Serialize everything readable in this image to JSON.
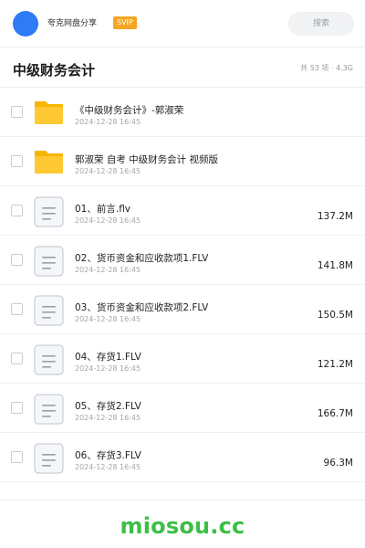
{
  "header": {
    "app_title": "夸克网盘分享",
    "badge": "SVIP",
    "search_placeholder": "搜索",
    "accent_color": "#2f7bf6",
    "badge_color": "#f5a623"
  },
  "folder": {
    "title": "中级财务会计",
    "meta": "共 53 项 · 4.3G"
  },
  "files": [
    {
      "type": "folder",
      "name": "《中级财务会计》-郭淑荣",
      "date": "2024-12-28 16:45",
      "size": ""
    },
    {
      "type": "folder",
      "name": "郭淑荣 自考 中级财务会计  视频版",
      "date": "2024-12-28 16:45",
      "size": ""
    },
    {
      "type": "file",
      "name": "01、前言.flv",
      "date": "2024-12-28 16:45",
      "size": "137.2M"
    },
    {
      "type": "file",
      "name": "02、货币资金和应收款项1.FLV",
      "date": "2024-12-28 16:45",
      "size": "141.8M"
    },
    {
      "type": "file",
      "name": "03、货币资金和应收款项2.FLV",
      "date": "2024-12-28 16:45",
      "size": "150.5M"
    },
    {
      "type": "file",
      "name": "04、存货1.FLV",
      "date": "2024-12-28 16:45",
      "size": "121.2M"
    },
    {
      "type": "file",
      "name": "05、存货2.FLV",
      "date": "2024-12-28 16:45",
      "size": "166.7M"
    },
    {
      "type": "file",
      "name": "06、存货3.FLV",
      "date": "2024-12-28 16:45",
      "size": "96.3M"
    }
  ],
  "footer": {
    "watermark": "miosou.cc",
    "watermark_color": "#3cbf46"
  }
}
